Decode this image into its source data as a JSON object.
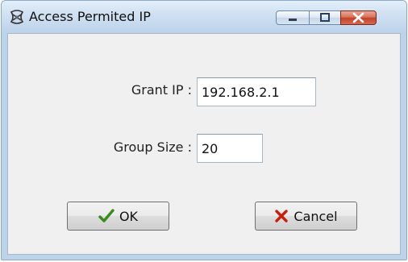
{
  "window": {
    "title": "Access Permited IP",
    "app_icon": "network-cross-icon"
  },
  "caption_buttons": {
    "minimize_icon": "minimize-icon",
    "maximize_icon": "maximize-icon",
    "close_icon": "close-icon"
  },
  "form": {
    "grant_ip_label": "Grant  IP :",
    "grant_ip_value": "192.168.2.1",
    "group_size_label": "Group Size :",
    "group_size_value": "20"
  },
  "buttons": {
    "ok_label": "OK",
    "ok_icon": "checkmark-icon",
    "cancel_label": "Cancel",
    "cancel_icon": "x-mark-icon"
  },
  "colors": {
    "ok_check": "#3b8a1e",
    "cancel_x": "#c81e0a",
    "close_button": "#c3412a",
    "title_bar": "#bcd3ea"
  }
}
